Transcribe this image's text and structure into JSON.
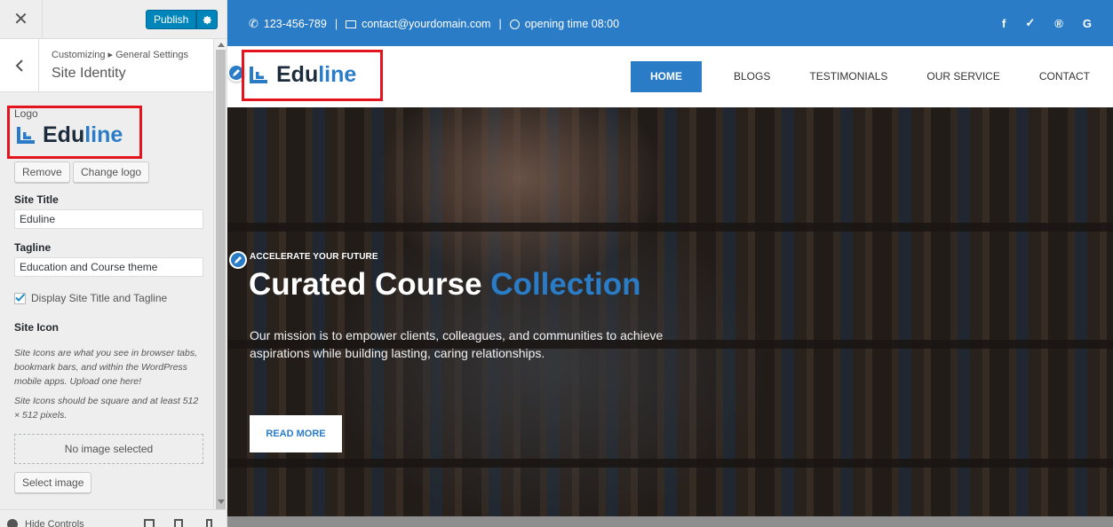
{
  "customizer": {
    "close_icon": "close-icon",
    "publish_label": "Publish",
    "breadcrumb_root": "Customizing",
    "breadcrumb_separator": "▸",
    "breadcrumb_parent": "General Settings",
    "section_title": "Site Identity",
    "logo_label": "Logo",
    "logo_brand_prefix": "Edu",
    "logo_brand_suffix": "line",
    "remove_button": "Remove",
    "change_logo_button": "Change logo",
    "site_title_label": "Site Title",
    "site_title_value": "Eduline",
    "tagline_label": "Tagline",
    "tagline_value": "Education and Course theme",
    "display_title_checkbox_label": "Display Site Title and Tagline",
    "display_title_checked": true,
    "site_icon_label": "Site Icon",
    "site_icon_desc_1": "Site Icons are what you see in browser tabs, bookmark bars, and within the WordPress mobile apps. Upload one here!",
    "site_icon_desc_2": "Site Icons should be square and at least 512 × 512 pixels.",
    "no_image_text": "No image selected",
    "select_image_button": "Select image",
    "hide_controls_label": "Hide Controls"
  },
  "site": {
    "phone": "123-456-789",
    "email": "contact@yourdomain.com",
    "opening_time": "opening time 08:00",
    "separator": "|",
    "social": [
      "f",
      "✓",
      "®",
      "G"
    ],
    "logo_prefix": "Edu",
    "logo_suffix": "line",
    "nav": [
      "HOME",
      "BLOGS",
      "TESTIMONIALS",
      "OUR SERVICE",
      "CONTACT"
    ],
    "hero_kicker": "ACCELERATE YOUR FUTURE",
    "hero_title_main": "Curated Course",
    "hero_title_accent": "Collection",
    "hero_description": "Our mission is to empower clients, colleagues, and communities to achieve aspirations while building lasting, caring relationships.",
    "read_more": "READ MORE"
  },
  "colors": {
    "brand_blue": "#2a7cc7",
    "wp_blue": "#0085ba",
    "highlight_red": "#e3141e"
  }
}
